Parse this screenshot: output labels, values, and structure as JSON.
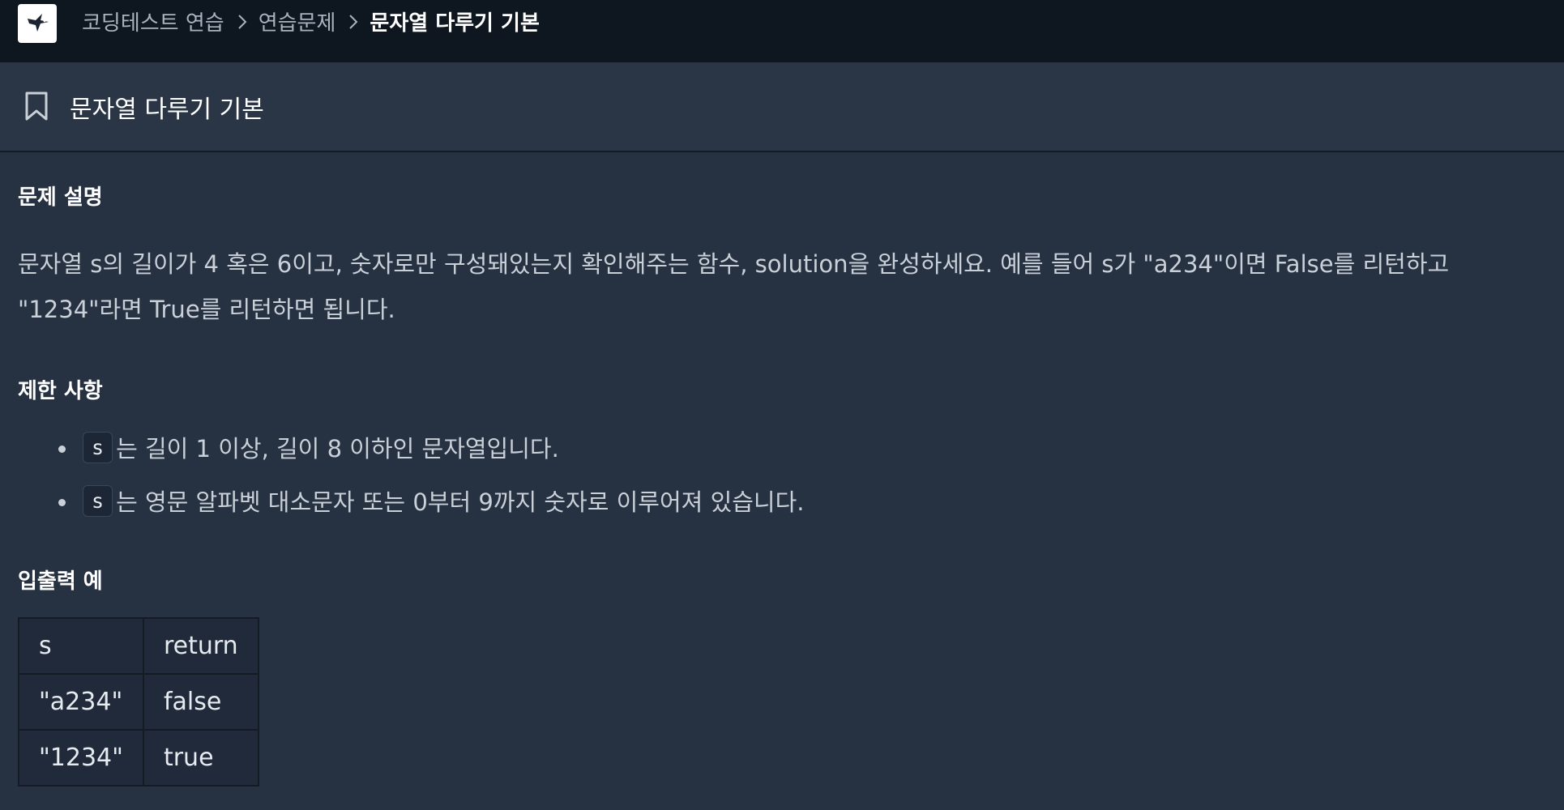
{
  "header": {
    "logo_icon": "hummingbird-logo-icon",
    "breadcrumb": [
      "코딩테스트 연습",
      "연습문제",
      "문자열 다루기 기본"
    ]
  },
  "title_bar": {
    "icon": "bookmark-icon",
    "title": "문자열 다루기 기본"
  },
  "problem": {
    "heading": "문제 설명",
    "description_line1": "문자열 s의 길이가 4 혹은 6이고, 숫자로만 구성돼있는지 확인해주는 함수, solution을 완성하세요. 예를 들어 s가 \"a234\"이면 False를 리턴하고",
    "description_line2": "\"1234\"라면 True를 리턴하면 됩니다."
  },
  "constraints": {
    "heading": "제한 사항",
    "items": [
      {
        "code": "s",
        "text": "는 길이 1 이상, 길이 8 이하인 문자열입니다."
      },
      {
        "code": "s",
        "text": "는 영문 알파벳 대소문자 또는 0부터 9까지 숫자로 이루어져 있습니다."
      }
    ]
  },
  "examples": {
    "heading": "입출력 예",
    "columns": [
      "s",
      "return"
    ],
    "rows": [
      [
        "\"a234\"",
        "false"
      ],
      [
        "\"1234\"",
        "true"
      ]
    ]
  },
  "colors": {
    "topbar": "#0e1620",
    "title_bar": "#2a3546",
    "content_bg": "#263142",
    "table_bg": "#202a3a"
  }
}
